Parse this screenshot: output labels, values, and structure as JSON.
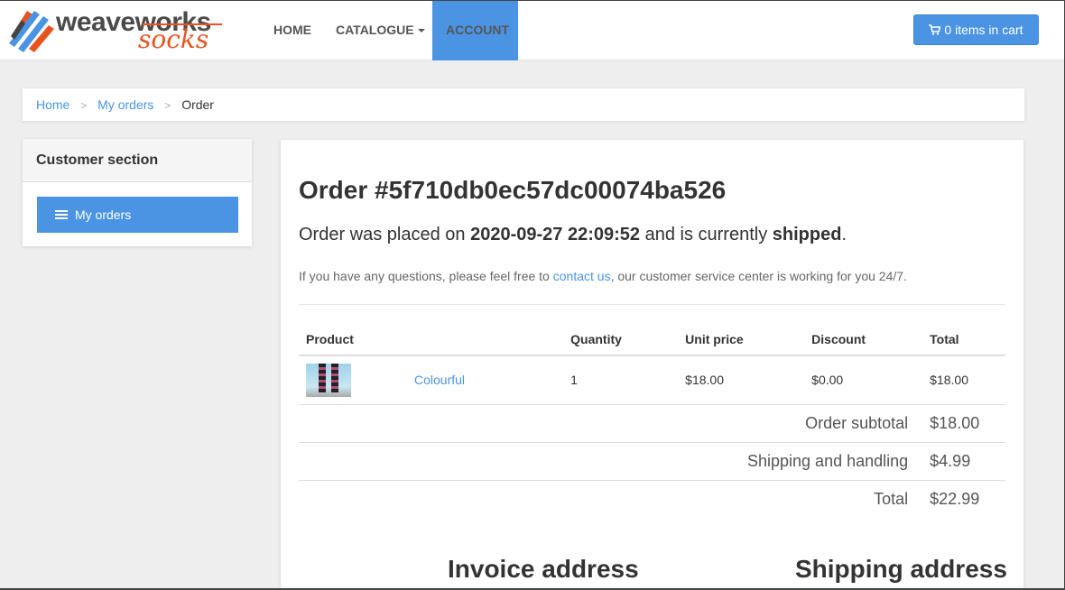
{
  "brand": {
    "word1": "weaveworks",
    "word2": "socks"
  },
  "nav": {
    "home": "HOME",
    "catalogue": "CATALOGUE",
    "account": "ACCOUNT",
    "cart": "0 items in cart"
  },
  "breadcrumb": {
    "home": "Home",
    "my_orders": "My orders",
    "current": "Order",
    "separator": ">"
  },
  "sidebar": {
    "title": "Customer section",
    "my_orders": "My orders"
  },
  "order": {
    "title": "Order #5f710db0ec57dc00074ba526",
    "lead_prefix": "Order was placed on ",
    "placed_on": "2020-09-27 22:09:52",
    "lead_mid": " and is currently ",
    "status": "shipped",
    "lead_suffix": ".",
    "help_prefix": "If you have any questions, please feel free to ",
    "help_link": "contact us",
    "help_suffix": ", our customer service center is working for you 24/7."
  },
  "table": {
    "headers": {
      "product": "Product",
      "quantity": "Quantity",
      "unit_price": "Unit price",
      "discount": "Discount",
      "total": "Total"
    },
    "items": [
      {
        "name": "Colourful",
        "quantity": "1",
        "unit_price": "$18.00",
        "discount": "$0.00",
        "total": "$18.00"
      }
    ],
    "summary": {
      "subtotal_label": "Order subtotal",
      "subtotal": "$18.00",
      "shipping_label": "Shipping and handling",
      "shipping": "$4.99",
      "total_label": "Total",
      "total": "$22.99"
    }
  },
  "addresses": {
    "invoice": "Invoice address",
    "shipping": "Shipping address"
  },
  "colors": {
    "accent": "#4a94e3",
    "brand_orange": "#e8531f"
  },
  "icons": {
    "cart": "shopping-cart-icon",
    "list": "list-icon",
    "caret": "caret-down-icon",
    "logo": "weaveworks-logo-icon"
  }
}
